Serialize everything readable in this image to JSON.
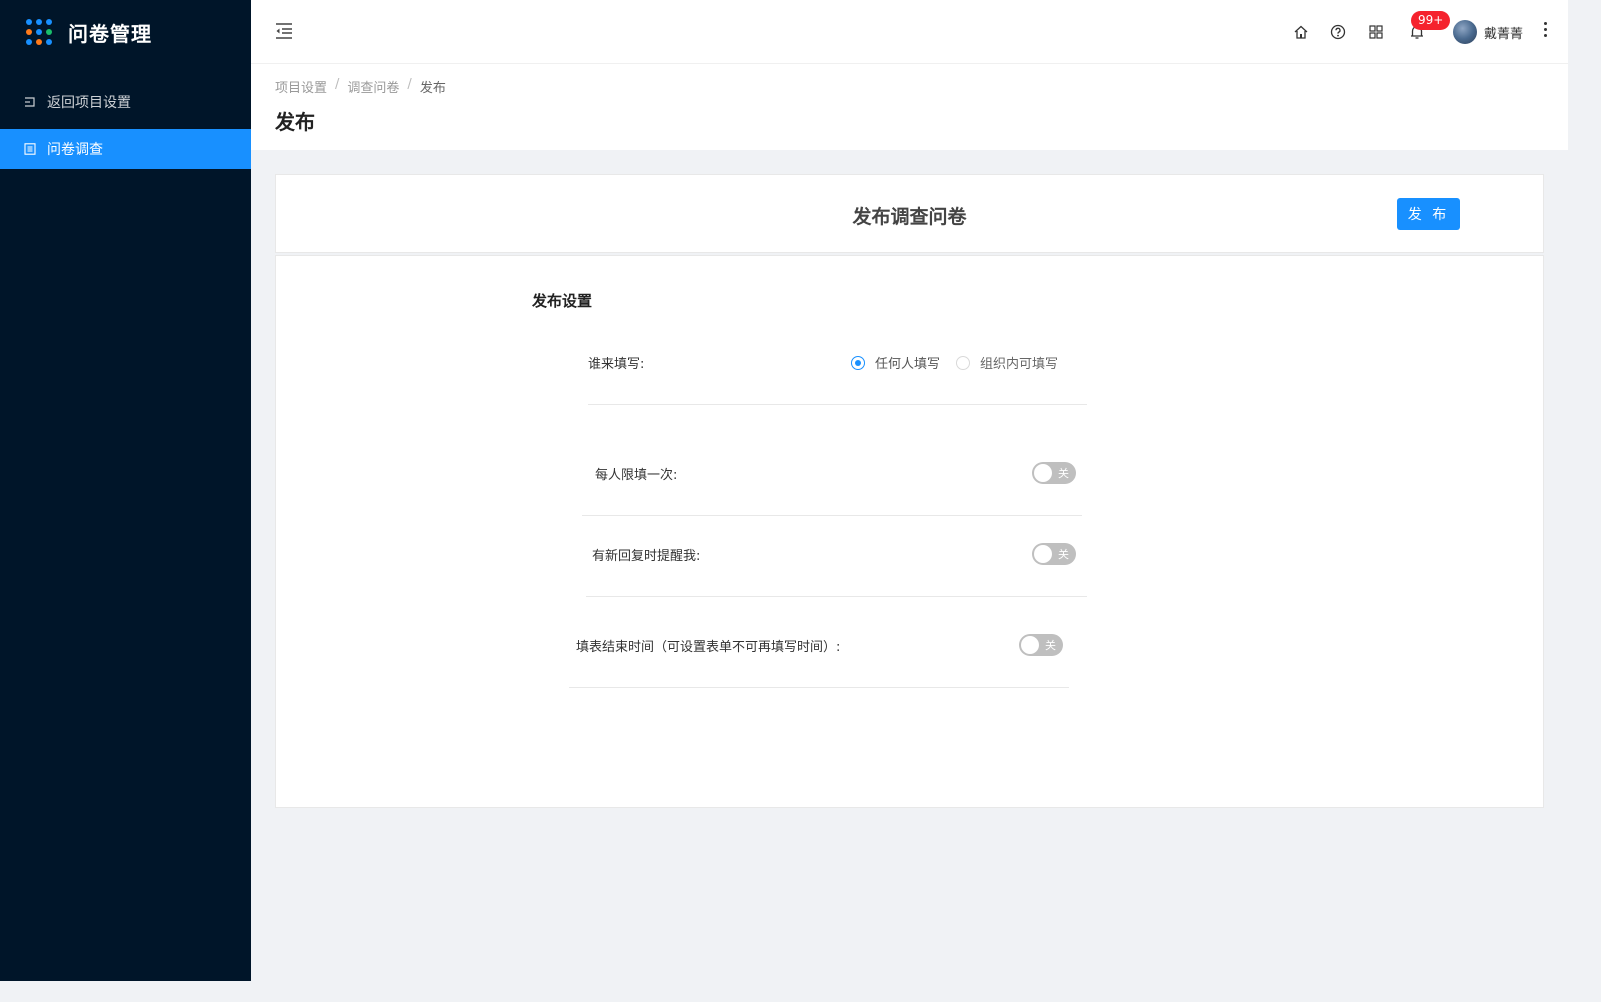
{
  "app": {
    "title": "问卷管理"
  },
  "sidebar": {
    "items": [
      {
        "label": "返回项目设置"
      },
      {
        "label": "问卷调查"
      }
    ]
  },
  "header": {
    "badge": "99+",
    "user_name": "戴菁菁"
  },
  "breadcrumb": [
    "项目设置",
    "调查问卷",
    "发布"
  ],
  "page_title": "发布",
  "publish_card": {
    "title": "发布调查问卷",
    "publish_button": "发 布"
  },
  "settings": {
    "section_title": "发布设置",
    "who_fill": {
      "label": "谁来填写:",
      "options": [
        "任何人填写",
        "组织内可填写"
      ],
      "selected": "任何人填写"
    },
    "once_per_person": {
      "label": "每人限填一次:",
      "state": "关"
    },
    "notify_reply": {
      "label": "有新回复时提醒我:",
      "state": "关"
    },
    "end_time": {
      "label": "填表结束时间（可设置表单不可再填写时间）:",
      "state": "关"
    }
  },
  "colors": {
    "sidebar_bg": "#001529",
    "accent": "#1890ff",
    "badge": "#f5222d",
    "page_bg": "#f0f2f5"
  }
}
